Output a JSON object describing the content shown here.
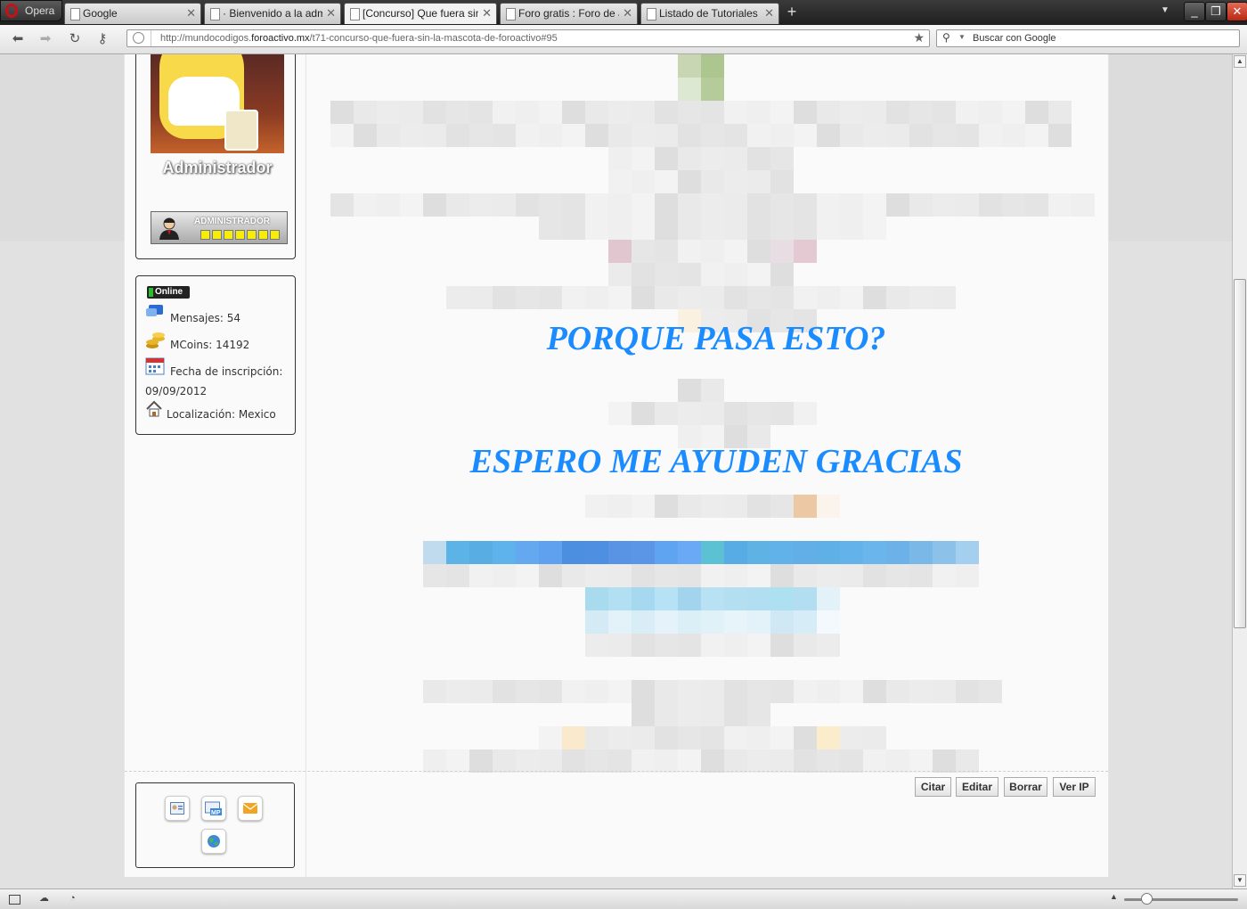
{
  "browser": {
    "menu_label": "Opera",
    "tabs": [
      {
        "title": "Google",
        "active": false
      },
      {
        "title": "· Bienvenido a la admi...",
        "active": false
      },
      {
        "title": "[Concurso] Que fuera sin l...",
        "active": true
      },
      {
        "title": "Foro gratis : Foro de a...",
        "active": false
      },
      {
        "title": "Listado de Tutoriales y...",
        "active": false
      }
    ],
    "url_prefix": "http://mundocodigos.",
    "url_domain": "foroactivo.mx",
    "url_path": "/t71-concurso-que-fuera-sin-la-mascota-de-foroactivo#95",
    "search_placeholder": "Buscar con Google"
  },
  "profile": {
    "username": "Administrador",
    "rank_label": "ADMINISTRADOR",
    "online_label": "Online",
    "posts_label": "Mensajes: 54",
    "coins_label": "MCoins: 14192",
    "joined_label": "Fecha de inscripción:",
    "joined_date": "09/09/2012",
    "location_label": "Localización: Mexico"
  },
  "post": {
    "heading_1": "PORQUE PASA ESTO?",
    "heading_2": "ESPERO ME AYUDEN GRACIAS",
    "accent_color": "#1a8cff"
  },
  "actions": {
    "quote": "Citar",
    "edit": "Editar",
    "delete": "Borrar",
    "view_ip": "Ver IP"
  },
  "contact_icons": [
    "profile-icon",
    "private-message-icon",
    "email-icon",
    "website-icon"
  ]
}
